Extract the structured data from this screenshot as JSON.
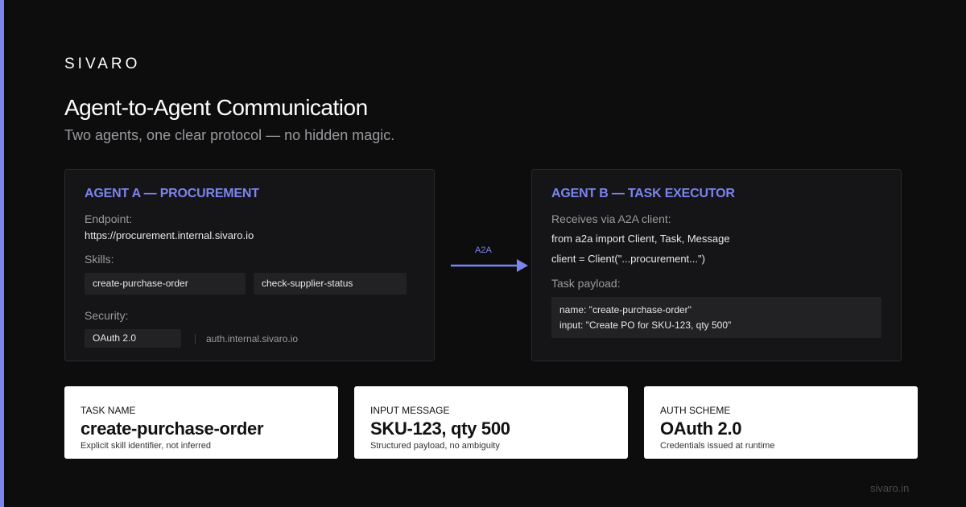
{
  "brand": "SIVARO",
  "title": "Agent-to-Agent Communication",
  "subtitle": "Two agents, one clear protocol — no hidden magic.",
  "agent_a": {
    "title": "AGENT A — PROCUREMENT",
    "endpoint_label": "Endpoint:",
    "endpoint_value": "https://procurement.internal.sivaro.io",
    "skills_label": "Skills:",
    "skills": [
      "create-purchase-order",
      "check-supplier-status"
    ],
    "security_label": "Security:",
    "security_scheme": "OAuth 2.0",
    "security_host": "auth.internal.sivaro.io"
  },
  "connector": {
    "label": "A2A"
  },
  "agent_b": {
    "title": "AGENT B — TASK EXECUTOR",
    "receives_label": "Receives via A2A client:",
    "code_lines": [
      "from a2a import Client, Task, Message",
      "client = Client(\"...procurement...\")"
    ],
    "payload_label": "Task payload:",
    "payload_lines": [
      "name: \"create-purchase-order\"",
      "input: \"Create PO for SKU-123, qty 500\""
    ]
  },
  "stats": [
    {
      "label": "TASK NAME",
      "value": "create-purchase-order",
      "note": "Explicit skill identifier, not inferred"
    },
    {
      "label": "INPUT MESSAGE",
      "value": "SKU-123, qty 500",
      "note": "Structured payload, no ambiguity"
    },
    {
      "label": "AUTH SCHEME",
      "value": "OAuth 2.0",
      "note": "Credentials issued at runtime"
    }
  ],
  "footer": "sivaro.in",
  "colors": {
    "accent": "#7c84f0",
    "background": "#0d0d0d",
    "card": "#151517"
  }
}
